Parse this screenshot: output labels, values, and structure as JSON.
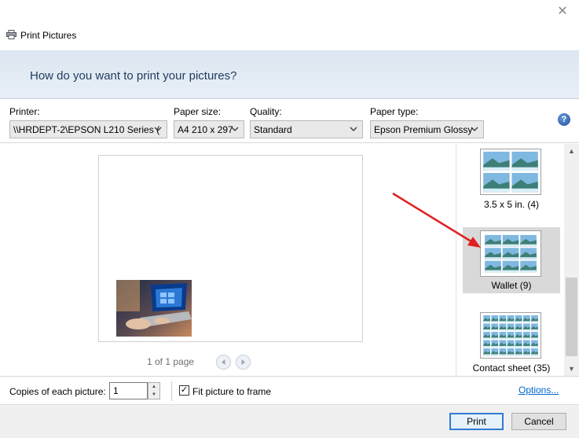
{
  "window": {
    "title": "Print Pictures",
    "close_glyph": "✕"
  },
  "header": {
    "question": "How do you want to print your pictures?"
  },
  "settings": {
    "printer": {
      "label": "Printer:",
      "value": "\\\\HRDEPT-2\\EPSON L210 Series ("
    },
    "paper_size": {
      "label": "Paper size:",
      "value": "A4 210 x 297"
    },
    "quality": {
      "label": "Quality:",
      "value": "Standard"
    },
    "paper_type": {
      "label": "Paper type:",
      "value": "Epson Premium Glossy"
    },
    "help_glyph": "?"
  },
  "preview": {
    "page_count": "1 of 1 page",
    "prev_glyph": "◀",
    "next_glyph": "▶"
  },
  "layouts": [
    {
      "label": "3.5 x 5 in. (4)",
      "selected": false
    },
    {
      "label": "Wallet (9)",
      "selected": true
    },
    {
      "label": "Contact sheet (35)",
      "selected": false
    }
  ],
  "scrollbar": {
    "up_glyph": "▲",
    "down_glyph": "▼"
  },
  "options": {
    "copies_label": "Copies of each picture:",
    "copies_value": "1",
    "fit_label": "Fit picture to frame",
    "fit_checked": true,
    "check_glyph": "✓",
    "options_link": "Options..."
  },
  "footer": {
    "print_label": "Print",
    "cancel_label": "Cancel"
  },
  "colors": {
    "accent": "#2f7bd7",
    "annotation_arrow": "#e02020",
    "header_text": "#1f3b5c"
  },
  "icons": [
    "printer-icon",
    "close-icon",
    "chevron-down-icon",
    "help-icon",
    "arrow-left-icon",
    "arrow-right-icon",
    "spinner-up-icon",
    "spinner-down-icon",
    "checkmark-icon"
  ]
}
